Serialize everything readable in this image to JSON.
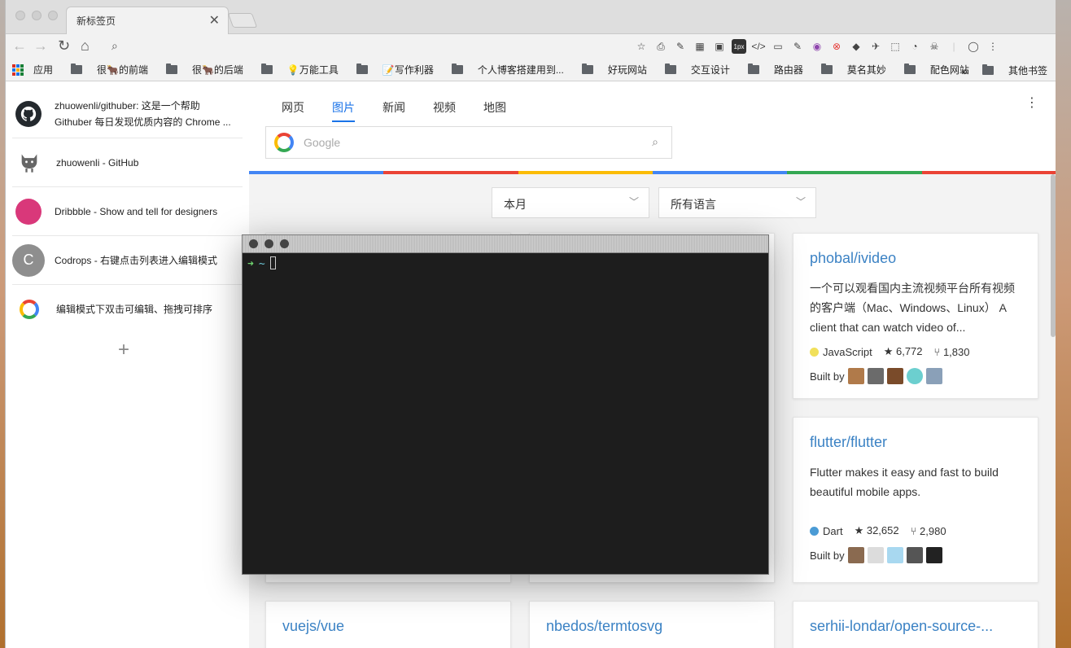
{
  "tab": {
    "title": "新标签页",
    "close": "✕"
  },
  "toolbar": {
    "back": "←",
    "forward": "→",
    "reload": "↻",
    "home": "⌂",
    "search_icon": "⌕",
    "extensions": [
      "☆",
      "⎙",
      "✎",
      "▦",
      "▣",
      "1px",
      "</>",
      "▭",
      "✎",
      "◉",
      "⊗",
      "◆",
      "✈",
      "⬚",
      "◔",
      "☠",
      "|",
      "◯",
      "⋮"
    ]
  },
  "bookmarks": {
    "apps_label": "应用",
    "items": [
      "很🐂的前端",
      "很🐂的后端",
      "💡万能工具",
      "📝写作利器",
      "个人博客搭建用到...",
      "好玩网站",
      "交互设计",
      "路由器",
      "莫名其妙",
      "配色网站"
    ],
    "more": "»",
    "other": "其他书签"
  },
  "sidebar": {
    "items": [
      {
        "text1": "zhuowenli/githuber: 这是一个帮助",
        "text2": "Githuber 每日发现优质内容的 Chrome ...",
        "icon": "github-icon",
        "color": "#24292e"
      },
      {
        "text1": "zhuowenli - GitHub",
        "text2": "",
        "icon": "octocat-icon",
        "color": "#ffffff"
      },
      {
        "text1": "Dribbble - Show and tell for designers",
        "text2": "",
        "icon": "dribbble-icon",
        "color": "#d9387a"
      },
      {
        "text1": "Codrops - 右键点击列表进入编辑模式",
        "text2": "",
        "icon": "codrops-icon",
        "letter": "C",
        "color": "#8e8e8e"
      },
      {
        "text1": "编辑模式下双击可编辑、拖拽可排序",
        "text2": "",
        "icon": "google-icon",
        "color": "#ffffff"
      }
    ],
    "add": "+"
  },
  "main": {
    "tabs": [
      "网页",
      "图片",
      "新闻",
      "视频",
      "地图"
    ],
    "active_tab": "图片",
    "kebab": "⋮",
    "search_placeholder": "Google",
    "filter_period": "本月",
    "filter_language": "所有语言",
    "chev": "﹀"
  },
  "colors": {
    "blue": "#4285f4",
    "red": "#ea4335",
    "yellow": "#fbbc05",
    "green": "#34a853",
    "link": "#3b82c4"
  },
  "cards": [
    {
      "title": "phobal/ivideo",
      "desc": "一个可以观看国内主流视频平台所有视频的客户端（Mac、Windows、Linux） A client that can watch video of...",
      "lang": "JavaScript",
      "lang_color": "#f1e05a",
      "stars": "6,772",
      "forks": "1,830",
      "built_by": "Built by"
    },
    {
      "title": "flutter/flutter",
      "desc": "Flutter makes it easy and fast to build beautiful mobile apps.",
      "lang": "Dart",
      "lang_color": "#4b9bd5",
      "stars": "32,652",
      "forks": "2,980",
      "built_by": "Built by"
    },
    {
      "title": "vuejs/vue"
    },
    {
      "title": "nbedos/termtosvg"
    },
    {
      "title": "serhii-londar/open-source-..."
    }
  ],
  "terminal": {
    "prompt_arrow": "➜",
    "path": "~"
  }
}
